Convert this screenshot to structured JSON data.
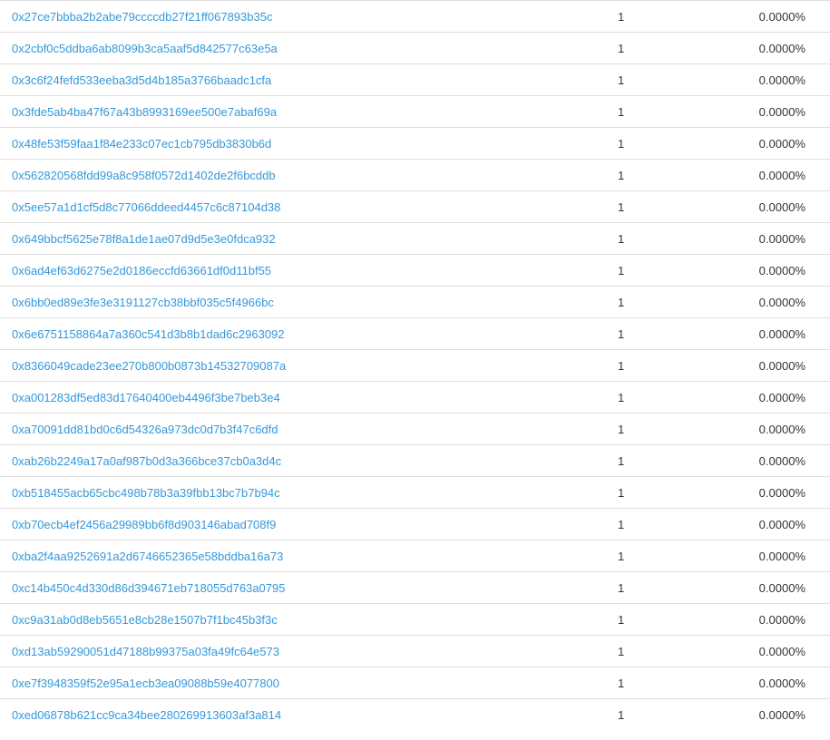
{
  "holders": [
    {
      "address": "0x27ce7bbba2b2abe79ccccdb27f21ff067893b35c",
      "quantity": "1",
      "percentage": "0.0000%"
    },
    {
      "address": "0x2cbf0c5ddba6ab8099b3ca5aaf5d842577c63e5a",
      "quantity": "1",
      "percentage": "0.0000%"
    },
    {
      "address": "0x3c6f24fefd533eeba3d5d4b185a3766baadc1cfa",
      "quantity": "1",
      "percentage": "0.0000%"
    },
    {
      "address": "0x3fde5ab4ba47f67a43b8993169ee500e7abaf69a",
      "quantity": "1",
      "percentage": "0.0000%"
    },
    {
      "address": "0x48fe53f59faa1f84e233c07ec1cb795db3830b6d",
      "quantity": "1",
      "percentage": "0.0000%"
    },
    {
      "address": "0x562820568fdd99a8c958f0572d1402de2f6bcddb",
      "quantity": "1",
      "percentage": "0.0000%"
    },
    {
      "address": "0x5ee57a1d1cf5d8c77066ddeed4457c6c87104d38",
      "quantity": "1",
      "percentage": "0.0000%"
    },
    {
      "address": "0x649bbcf5625e78f8a1de1ae07d9d5e3e0fdca932",
      "quantity": "1",
      "percentage": "0.0000%"
    },
    {
      "address": "0x6ad4ef63d6275e2d0186eccfd63661df0d11bf55",
      "quantity": "1",
      "percentage": "0.0000%"
    },
    {
      "address": "0x6bb0ed89e3fe3e3191127cb38bbf035c5f4966bc",
      "quantity": "1",
      "percentage": "0.0000%"
    },
    {
      "address": "0x6e6751158864a7a360c541d3b8b1dad6c2963092",
      "quantity": "1",
      "percentage": "0.0000%"
    },
    {
      "address": "0x8366049cade23ee270b800b0873b14532709087a",
      "quantity": "1",
      "percentage": "0.0000%"
    },
    {
      "address": "0xa001283df5ed83d17640400eb4496f3be7beb3e4",
      "quantity": "1",
      "percentage": "0.0000%"
    },
    {
      "address": "0xa70091dd81bd0c6d54326a973dc0d7b3f47c6dfd",
      "quantity": "1",
      "percentage": "0.0000%"
    },
    {
      "address": "0xab26b2249a17a0af987b0d3a366bce37cb0a3d4c",
      "quantity": "1",
      "percentage": "0.0000%"
    },
    {
      "address": "0xb518455acb65cbc498b78b3a39fbb13bc7b7b94c",
      "quantity": "1",
      "percentage": "0.0000%"
    },
    {
      "address": "0xb70ecb4ef2456a29989bb6f8d903146abad708f9",
      "quantity": "1",
      "percentage": "0.0000%"
    },
    {
      "address": "0xba2f4aa9252691a2d6746652365e58bddba16a73",
      "quantity": "1",
      "percentage": "0.0000%"
    },
    {
      "address": "0xc14b450c4d330d86d394671eb718055d763a0795",
      "quantity": "1",
      "percentage": "0.0000%"
    },
    {
      "address": "0xc9a31ab0d8eb5651e8cb28e1507b7f1bc45b3f3c",
      "quantity": "1",
      "percentage": "0.0000%"
    },
    {
      "address": "0xd13ab59290051d47188b99375a03fa49fc64e573",
      "quantity": "1",
      "percentage": "0.0000%"
    },
    {
      "address": "0xe7f3948359f52e95a1ecb3ea09088b59e4077800",
      "quantity": "1",
      "percentage": "0.0000%"
    },
    {
      "address": "0xed06878b621cc9ca34bee280269913603af3a814",
      "quantity": "1",
      "percentage": "0.0000%"
    }
  ],
  "colors": {
    "link": "#3498db",
    "text": "#333333",
    "border": "#dddddd"
  }
}
